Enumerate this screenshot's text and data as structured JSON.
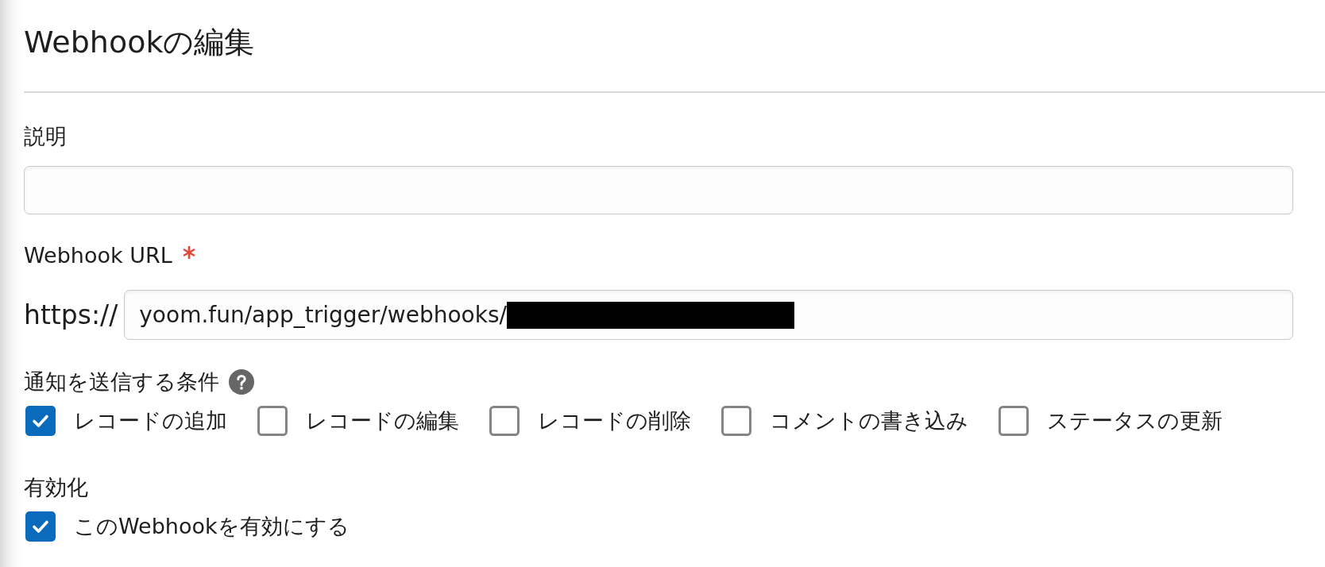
{
  "page": {
    "title": "Webhookの編集"
  },
  "description": {
    "label": "説明"
  },
  "webhook_url": {
    "label": "Webhook URL",
    "required": true,
    "prefix": "https://",
    "value": "yoom.fun/app_trigger/webhooks/",
    "redacted": true
  },
  "conditions": {
    "label": "通知を送信する条件",
    "help": true,
    "options": [
      {
        "label": "レコードの追加",
        "checked": true
      },
      {
        "label": "レコードの編集",
        "checked": false
      },
      {
        "label": "レコードの削除",
        "checked": false
      },
      {
        "label": "コメントの書き込み",
        "checked": false
      },
      {
        "label": "ステータスの更新",
        "checked": false
      }
    ]
  },
  "activation": {
    "label": "有効化",
    "options": [
      {
        "label": "このWebhookを有効にする",
        "checked": true
      }
    ]
  }
}
